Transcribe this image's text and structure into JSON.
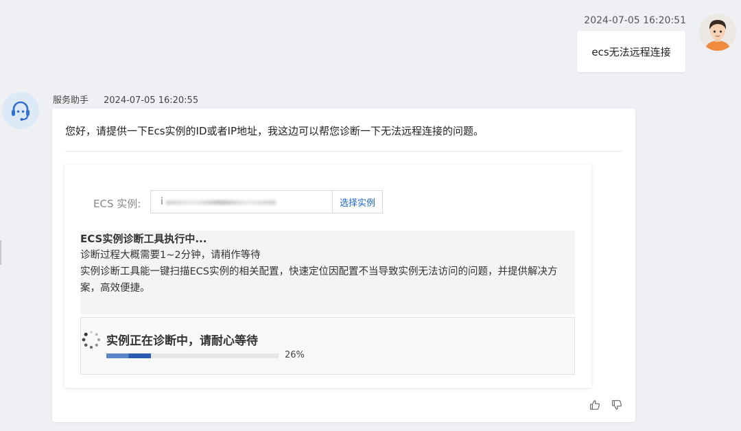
{
  "user_message": {
    "timestamp": "2024-07-05 16:20:51",
    "text": "ecs无法远程连接"
  },
  "bot_message": {
    "sender": "服务助手",
    "timestamp": "2024-07-05 16:20:55",
    "greeting": "您好，请提供一下Ecs实例的ID或者IP地址，我这边可以帮您诊断一下无法远程连接的问题。"
  },
  "tool": {
    "ecs_label": "ECS 实例:",
    "input_value": "i",
    "select_button": "选择实例",
    "status_title": "ECS实例诊断工具执行中...",
    "status_line1": "诊断过程大概需要1~2分钟，请稍作等待",
    "status_line2": "实例诊断工具能一键扫描ECS实例的相关配置，快速定位因配置不当导致实例无法访问的问题，并提供解决方案，高效便捷。",
    "progress_title": "实例正在诊断中，请耐心等待",
    "progress_value": 26,
    "progress_text": "26%"
  },
  "colors": {
    "accent": "#1a66c8",
    "progress": "#2b5bb0",
    "background": "#eef0f3"
  },
  "icons": {
    "user_avatar": "user-avatar-icon",
    "bot_avatar": "headset-icon",
    "spinner": "spinner-icon",
    "like": "thumbs-up-icon",
    "dislike": "thumbs-down-icon"
  }
}
